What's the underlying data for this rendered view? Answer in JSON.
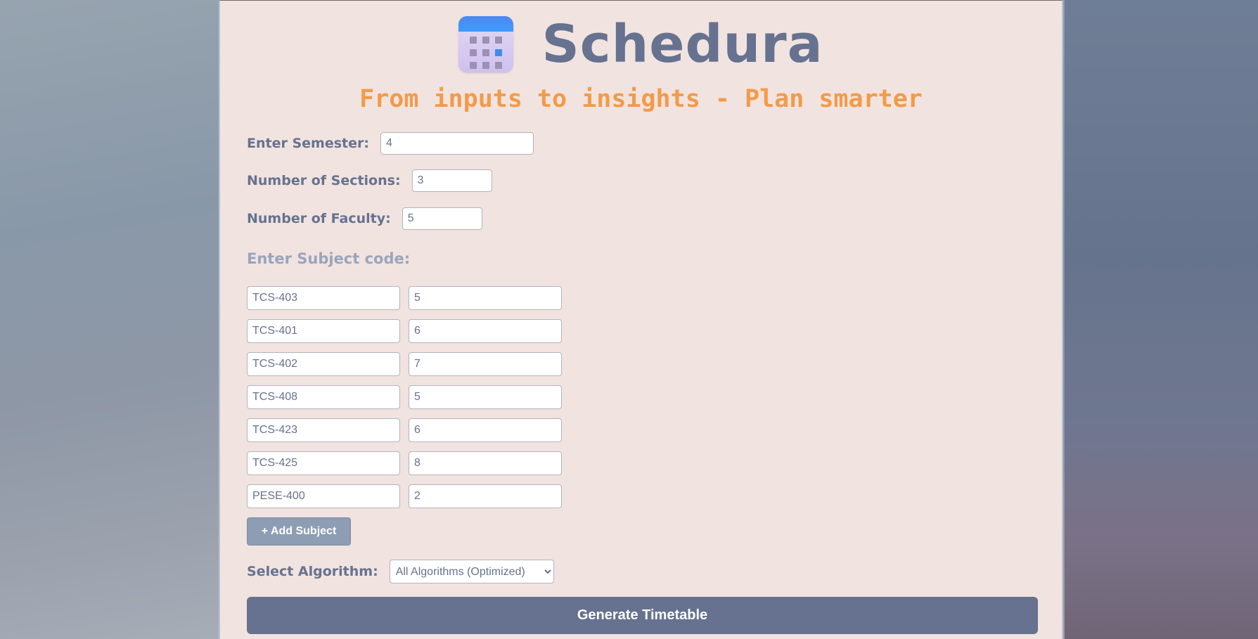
{
  "header": {
    "app_title": "Schedura",
    "tagline": "From inputs to insights - Plan smarter",
    "logo_icon": "calendar-icon"
  },
  "form": {
    "semester": {
      "label": "Enter Semester:",
      "value": "4"
    },
    "sections": {
      "label": "Number of Sections:",
      "value": "3"
    },
    "faculty": {
      "label": "Number of Faculty:",
      "value": "5"
    }
  },
  "subjects": {
    "heading": "Enter Subject code:",
    "rows": [
      {
        "code": "TCS-403",
        "count": "5"
      },
      {
        "code": "TCS-401",
        "count": "6"
      },
      {
        "code": "TCS-402",
        "count": "7"
      },
      {
        "code": "TCS-408",
        "count": "5"
      },
      {
        "code": "TCS-423",
        "count": "6"
      },
      {
        "code": "TCS-425",
        "count": "8"
      },
      {
        "code": "PESE-400",
        "count": "2"
      }
    ],
    "add_label": "+ Add Subject"
  },
  "algorithm": {
    "label": "Select Algorithm:",
    "selected": "All Algorithms (Optimized)"
  },
  "generate_label": "Generate Timetable",
  "colors": {
    "panel_bg": "#f1e3df",
    "primary": "#66728f",
    "accent": "#f29b4a",
    "muted_heading": "#99a5bc",
    "add_button": "#8d9db3"
  }
}
